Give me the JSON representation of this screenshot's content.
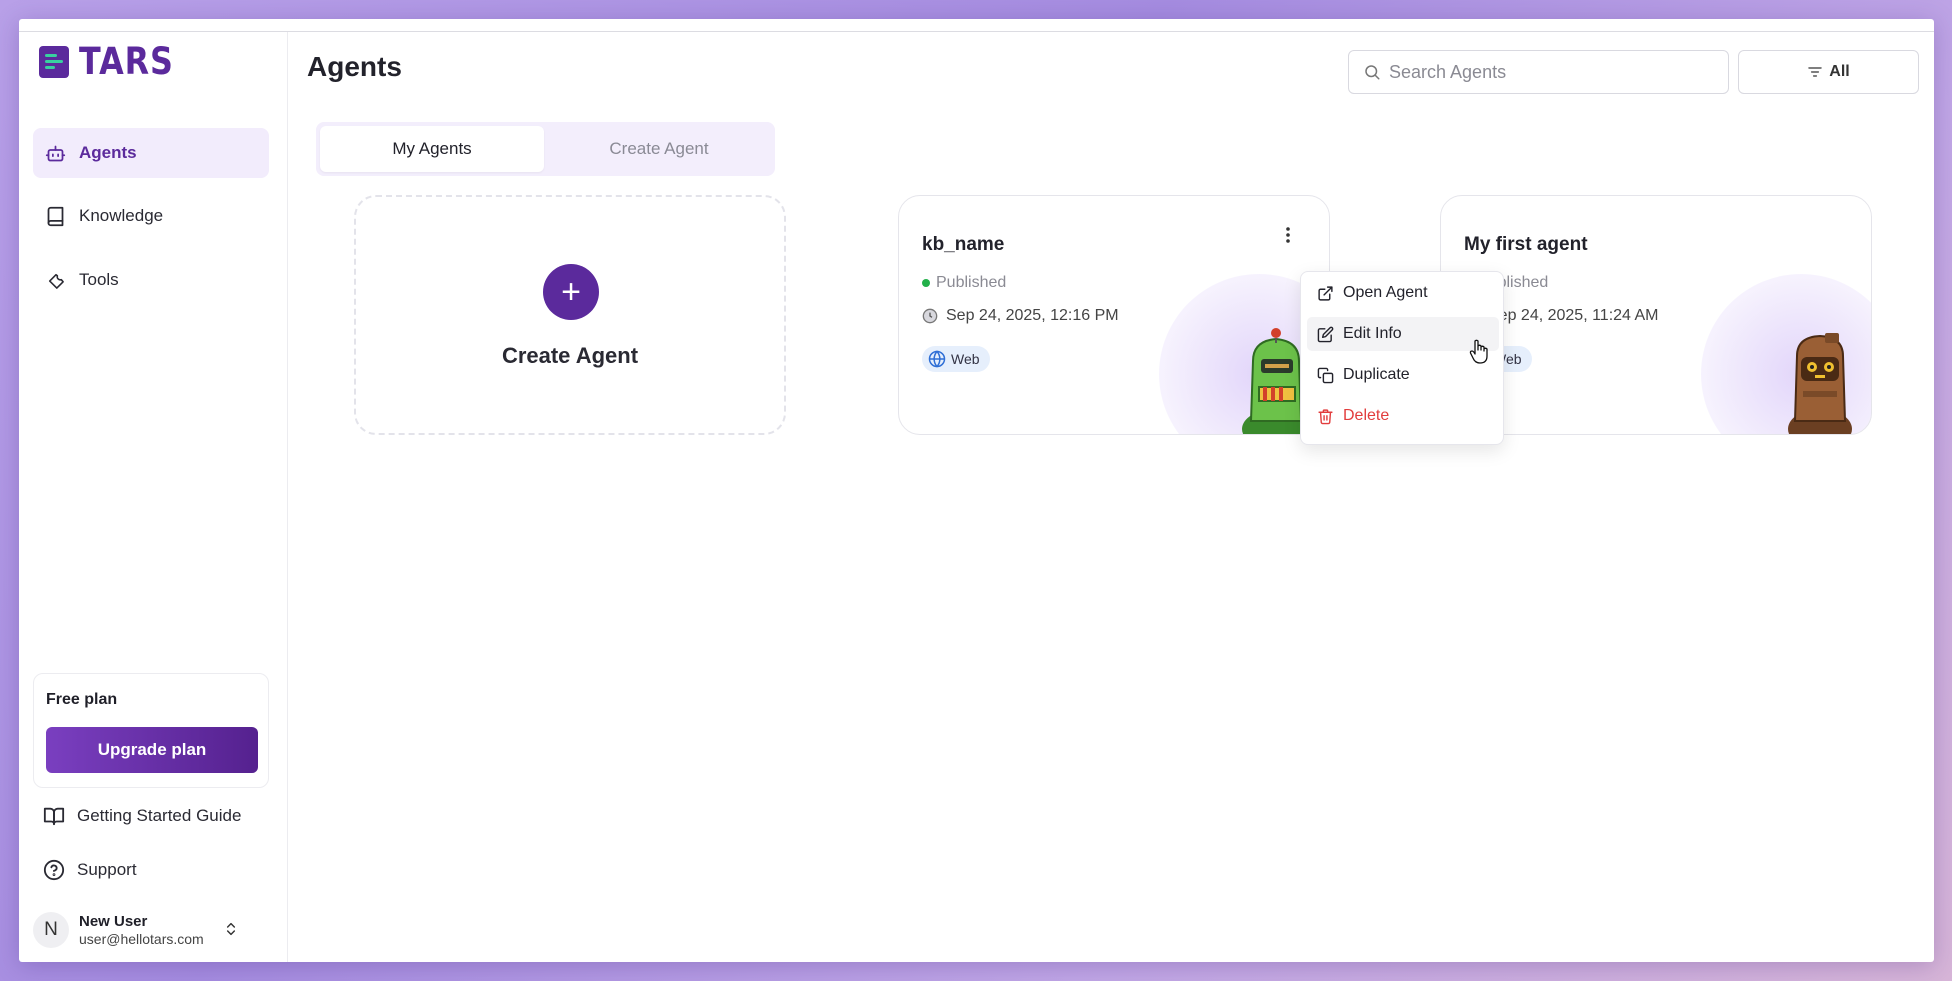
{
  "app": {
    "brand": "TARS"
  },
  "sidebar": {
    "items": [
      {
        "label": "Agents",
        "icon": "bot-icon"
      },
      {
        "label": "Knowledge",
        "icon": "book-icon"
      },
      {
        "label": "Tools",
        "icon": "wrench-icon"
      }
    ],
    "plan": {
      "title": "Free plan",
      "button": "Upgrade plan"
    },
    "links": [
      {
        "label": "Getting Started Guide",
        "icon": "open-book-icon"
      },
      {
        "label": "Support",
        "icon": "help-circle-icon"
      }
    ],
    "user": {
      "initial": "N",
      "name": "New User",
      "email": "user@hellotars.com"
    }
  },
  "header": {
    "title": "Agents",
    "search_placeholder": "Search Agents",
    "filter_label": "All"
  },
  "tabs": [
    {
      "label": "My Agents",
      "active": true
    },
    {
      "label": "Create Agent",
      "active": false
    }
  ],
  "create_card": {
    "label": "Create Agent"
  },
  "agents": [
    {
      "name": "kb_name",
      "status": "Published",
      "date": "Sep 24, 2025, 12:16 PM",
      "channel": "Web"
    },
    {
      "name": "My first agent",
      "status": "Published",
      "date": "Sep 24, 2025, 11:24 AM",
      "channel": "Web"
    }
  ],
  "context_menu": {
    "items": [
      {
        "label": "Open Agent",
        "icon": "external-link-icon"
      },
      {
        "label": "Edit Info",
        "icon": "edit-icon"
      },
      {
        "label": "Duplicate",
        "icon": "copy-icon"
      },
      {
        "label": "Delete",
        "icon": "trash-icon"
      }
    ]
  },
  "colors": {
    "brand": "#5b2a9c",
    "accent_bg": "#f2ecfc",
    "danger": "#e23d3d",
    "status_published": "#22b04a",
    "chip_bg": "#e6effc"
  }
}
